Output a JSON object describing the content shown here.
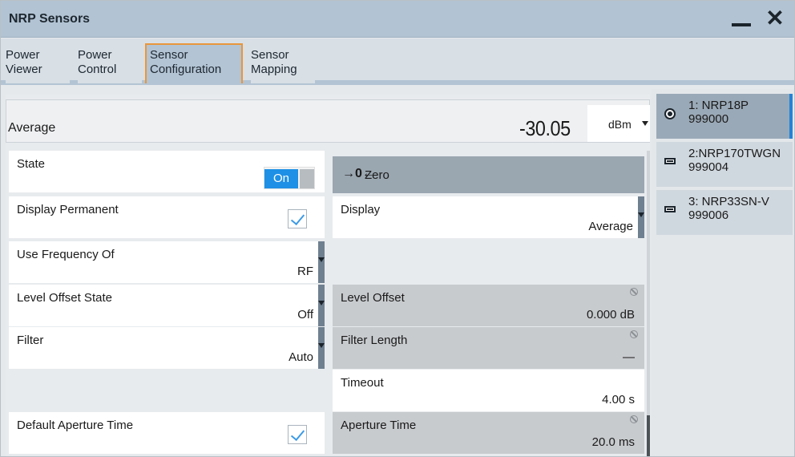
{
  "window": {
    "title": "NRP Sensors"
  },
  "tabs": [
    {
      "label": "Power\nViewer"
    },
    {
      "label": "Power\nControl"
    },
    {
      "label": "Sensor\nConfiguration"
    },
    {
      "label": "Sensor\nMapping"
    }
  ],
  "average": {
    "label": "Average",
    "value": "-30.05",
    "unit": "dBm"
  },
  "left": {
    "state": {
      "label": "State",
      "value": "On"
    },
    "display_permanent": {
      "label": "Display Permanent",
      "checked": true
    },
    "use_frequency": {
      "label": "Use Frequency Of",
      "value": "RF"
    },
    "level_offset_state": {
      "label": "Level Offset State",
      "value": "Off"
    },
    "filter": {
      "label": "Filter",
      "value": "Auto"
    },
    "default_aperture": {
      "label": "Default Aperture Time",
      "checked": true
    }
  },
  "right": {
    "zero": {
      "icon": "→0←",
      "label": "Zero"
    },
    "display": {
      "label": "Display",
      "value": "Average"
    },
    "level_offset": {
      "label": "Level Offset",
      "value": "0.000 dB"
    },
    "filter_length": {
      "label": "Filter Length",
      "value": "—"
    },
    "timeout": {
      "label": "Timeout",
      "value": "4.00 s"
    },
    "aperture_time": {
      "label": "Aperture Time",
      "value": "20.0 ms"
    }
  },
  "sensors": [
    {
      "label": "1: NRP18P\n999000",
      "icon": "thermal-sensor-icon",
      "selected": true
    },
    {
      "label": "2:NRP170TWGN\n999004",
      "icon": "waveguide-sensor-icon"
    },
    {
      "label": "3: NRP33SN-V\n999006",
      "icon": "usb-sensor-icon"
    }
  ],
  "colors": {
    "accent": "#1e90e6",
    "active_tab_border": "#e9963a",
    "titlebar": "#b2c3d3"
  }
}
